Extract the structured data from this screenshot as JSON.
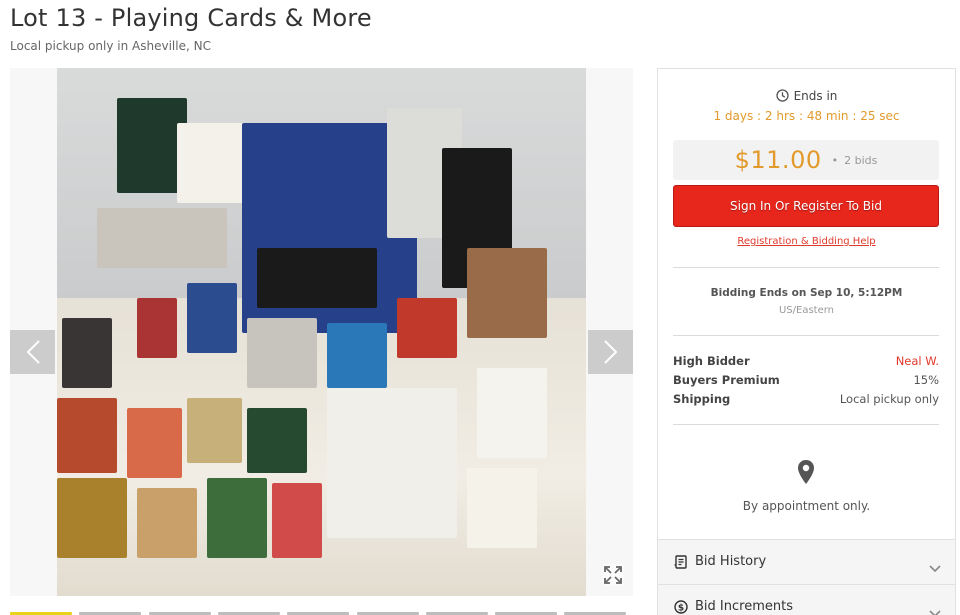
{
  "lot": {
    "title": "Lot 13 - Playing Cards & More",
    "location": "Local pickup only in Asheville, NC"
  },
  "gallery": {
    "image_alt": "Playing cards, bridge books and card games",
    "prev_icon": "chevron-left-icon",
    "next_icon": "chevron-right-icon",
    "expand_icon": "expand-icon",
    "thumbnail_count": 9,
    "active_thumbnail": 0
  },
  "bidding": {
    "ends_label": "Ends in",
    "countdown": "1 days : 2 hrs : 48 min : 25 sec",
    "current_bid": "$11.00",
    "separator": "•",
    "bid_count": "2 bids",
    "bid_button_label": "Sign In Or Register To Bid",
    "help_link": "Registration & Bidding Help",
    "ends_on": "Bidding Ends on Sep 10, 5:12PM",
    "timezone": "US/Eastern"
  },
  "details": [
    {
      "label": "High Bidder",
      "value": "Neal W."
    },
    {
      "label": "Buyers Premium",
      "value": "15%"
    },
    {
      "label": "Shipping",
      "value": "Local pickup only"
    }
  ],
  "pickup": {
    "icon": "map-marker-icon",
    "note": "By appointment only."
  },
  "accordions": [
    {
      "label": "Bid History",
      "icon": "receipt-icon"
    },
    {
      "label": "Bid Increments",
      "icon": "dollar-circle-icon"
    }
  ],
  "colors": {
    "accent": "#e29a2c",
    "bid_button": "#e7261c",
    "link": "#e03a2b",
    "active_thumbnail": "#e8d31a"
  }
}
